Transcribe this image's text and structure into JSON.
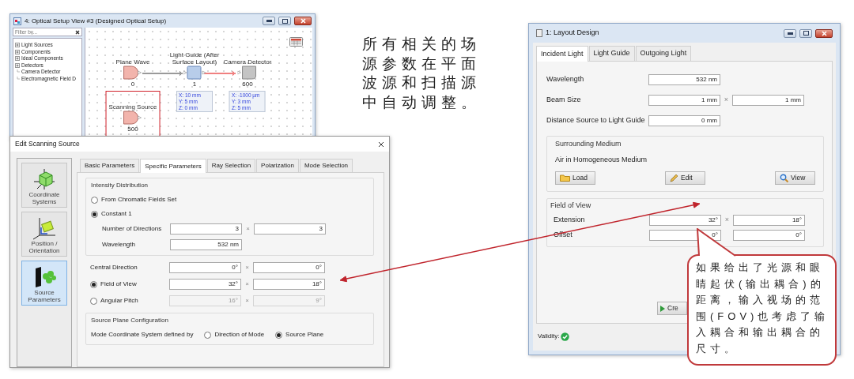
{
  "setup_view": {
    "title": "4: Optical Setup View #3 (Designed Optical Setup)",
    "filter": {
      "placeholder": "Filter by..."
    },
    "tree": [
      {
        "label": "Light Sources",
        "kind": "group"
      },
      {
        "label": "Components",
        "kind": "group"
      },
      {
        "label": "Ideal Components",
        "kind": "group"
      },
      {
        "label": "Detectors",
        "kind": "group"
      },
      {
        "label": "Camera Detector",
        "kind": "leaf"
      },
      {
        "label": "Electromagnetic Field D",
        "kind": "leaf"
      }
    ],
    "nodes": [
      {
        "label": "Plane Wave",
        "number": "0",
        "kind": "source",
        "selected": false
      },
      {
        "label": "Light Guide (After Surface Layout)",
        "number": "1",
        "kind": "guide",
        "selected": false,
        "position": [
          "X: 10 mm",
          "Y: 5 mm",
          "Z: 0 mm"
        ]
      },
      {
        "label": "Camera Detector",
        "number": "600",
        "kind": "detector",
        "selected": false,
        "position": [
          "X: -1000 µm",
          "Y: 3 mm",
          "Z: 5 mm"
        ]
      },
      {
        "label": "Scanning Source",
        "number": "500",
        "kind": "source",
        "selected": true
      }
    ],
    "links": [
      {
        "color": "#9a9a9a"
      },
      {
        "color": "#f08080"
      }
    ]
  },
  "note": "所有相关的场源参数在平面波源和扫描源中自动调整。",
  "edit_dialog": {
    "title": "Edit Scanning Source",
    "sections": [
      {
        "label": "Coordinate Systems",
        "kind": "coordinates",
        "selected": false
      },
      {
        "label": "Position / Orientation",
        "kind": "position",
        "selected": false
      },
      {
        "label": "Source Parameters",
        "kind": "source",
        "selected": true
      }
    ],
    "tabs": [
      {
        "label": "Basic Parameters",
        "selected": false
      },
      {
        "label": "Specific Parameters",
        "selected": true
      },
      {
        "label": "Ray Selection",
        "selected": false
      },
      {
        "label": "Polarization",
        "selected": false
      },
      {
        "label": "Mode Selection",
        "selected": false
      }
    ],
    "intensity": {
      "title": "Intensity Distribution",
      "options": [
        {
          "label": "From Chromatic Fields Set",
          "selected": false
        },
        {
          "label": "Constant 1",
          "selected": true
        }
      ],
      "rows": [
        {
          "label": "Number of Directions",
          "values": [
            "3",
            "3"
          ],
          "separator": "×"
        },
        {
          "label": "Wavelength",
          "values": [
            "532 nm"
          ]
        }
      ]
    },
    "direction_rows": [
      {
        "label": "Central Direction",
        "kind": "plain",
        "disabled": false,
        "values": [
          "0°",
          "0°"
        ],
        "separator": "×"
      },
      {
        "label": "Field of View",
        "kind": "radio",
        "selected": true,
        "disabled": false,
        "values": [
          "32°",
          "18°"
        ],
        "separator": "×"
      },
      {
        "label": "Angular Pitch",
        "kind": "radio",
        "selected": false,
        "disabled": true,
        "values": [
          "16°",
          "9°"
        ],
        "separator": "×"
      }
    ],
    "plane": {
      "title": "Source Plane Configuration",
      "label": "Mode Coordinate System defined by",
      "options": [
        {
          "label": "Direction of Mode",
          "selected": false
        },
        {
          "label": "Source Plane",
          "selected": true
        }
      ]
    }
  },
  "layout_design": {
    "title": "1: Layout Design",
    "tabs": [
      {
        "label": "Incident Light",
        "selected": true
      },
      {
        "label": "Light Guide",
        "selected": false
      },
      {
        "label": "Outgoing Light",
        "selected": false
      }
    ],
    "rows": [
      {
        "label": "Wavelength",
        "values": [
          "532 nm"
        ]
      },
      {
        "label": "Beam Size",
        "values": [
          "1 mm",
          "1 mm"
        ],
        "separator": "×"
      },
      {
        "label": "Distance Source to Light Guide",
        "values": [
          "0 mm"
        ]
      }
    ],
    "medium": {
      "title": "Surrounding Medium",
      "value": "Air in Homogeneous Medium",
      "buttons": [
        {
          "label": "Load",
          "kind": "load"
        },
        {
          "label": "Edit",
          "kind": "edit"
        },
        {
          "label": "View",
          "kind": "view"
        }
      ]
    },
    "fov": {
      "title": "Field of View",
      "rows": [
        {
          "label": "Extension",
          "values": [
            "32°",
            "18°"
          ],
          "separator": "×"
        },
        {
          "label": "Offset",
          "values": [
            "0°",
            "0°"
          ]
        }
      ]
    },
    "create_button": "Cre",
    "validity": {
      "label": "Validity:",
      "valid": true
    }
  },
  "callout": "如果给出了光源和眼睛起伏(输出耦合)的距离，输入视场的范围(FOV)也考虑了输入耦合和输出耦合的尺寸。"
}
